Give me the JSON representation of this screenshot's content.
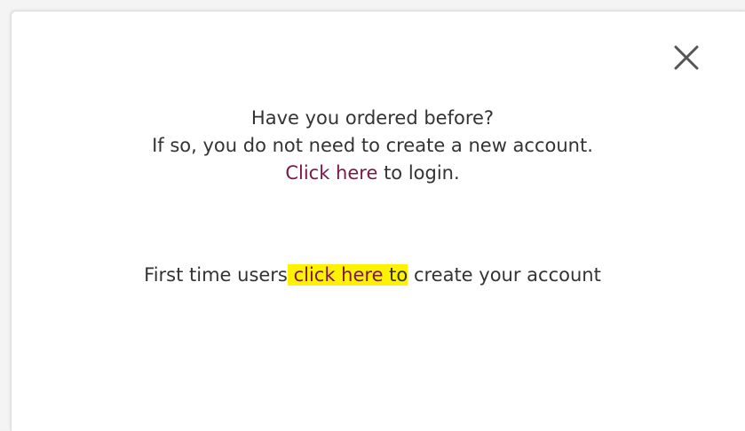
{
  "modal": {
    "close_icon": "close-icon",
    "line1": "Have you ordered before?",
    "line2": "If so, you do not need to create a new account.",
    "login_link": "Click here",
    "login_suffix": " to login.",
    "first_time_prefix": "First time users",
    "first_time_space": " ",
    "create_link": "click here",
    "create_link_to": " to",
    "first_time_suffix": " create your account"
  },
  "colors": {
    "link": "#7a1848",
    "highlight": "#fff200",
    "text": "#333333"
  }
}
